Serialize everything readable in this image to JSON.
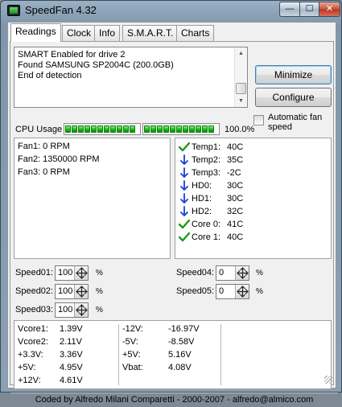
{
  "window": {
    "title": "SpeedFan 4.32",
    "min_glyph": "—",
    "max_glyph": "☐",
    "close_glyph": "✕"
  },
  "tabs": [
    {
      "label": "Readings",
      "active": true
    },
    {
      "label": "Clock"
    },
    {
      "label": "Info"
    },
    {
      "label": "S.M.A.R.T."
    },
    {
      "label": "Charts"
    }
  ],
  "log": [
    "SMART Enabled for drive 2",
    "Found SAMSUNG SP2004C (200.0GB)",
    "End of detection"
  ],
  "buttons": {
    "minimize": "Minimize",
    "configure": "Configure"
  },
  "auto_fan": {
    "label": "Automatic fan speed",
    "checked": false
  },
  "cpu": {
    "label": "CPU Usage",
    "percent_text": "100.0%",
    "usage": 1.0
  },
  "fans": [
    "Fan1: 0 RPM",
    "Fan2: 1350000 RPM",
    "Fan3: 0 RPM"
  ],
  "temps": [
    {
      "name": "Temp1:",
      "value": "40C",
      "icon": "check-icon"
    },
    {
      "name": "Temp2:",
      "value": "35C",
      "icon": "arrow-down-icon"
    },
    {
      "name": "Temp3:",
      "value": "-2C",
      "icon": "arrow-down-icon"
    },
    {
      "name": "HD0:",
      "value": "30C",
      "icon": "arrow-down-icon"
    },
    {
      "name": "HD1:",
      "value": "30C",
      "icon": "arrow-down-icon"
    },
    {
      "name": "HD2:",
      "value": "32C",
      "icon": "arrow-down-icon"
    },
    {
      "name": "Core 0:",
      "value": "41C",
      "icon": "check-icon"
    },
    {
      "name": "Core 1:",
      "value": "40C",
      "icon": "check-icon"
    }
  ],
  "speeds": [
    {
      "label": "Speed01:",
      "value": "100",
      "unit": "%"
    },
    {
      "label": "Speed02:",
      "value": "100",
      "unit": "%"
    },
    {
      "label": "Speed03:",
      "value": "100",
      "unit": "%"
    },
    {
      "label": "Speed04:",
      "value": "0",
      "unit": "%"
    },
    {
      "label": "Speed05:",
      "value": "0",
      "unit": "%"
    }
  ],
  "voltages": [
    {
      "name": "Vcore1:",
      "value": "1.39V"
    },
    {
      "name": "Vcore2:",
      "value": "2.11V"
    },
    {
      "name": "+3.3V:",
      "value": "3.36V"
    },
    {
      "name": "+5V:",
      "value": "4.95V"
    },
    {
      "name": "+12V:",
      "value": "4.61V"
    },
    {
      "name": "-12V:",
      "value": "-16.97V"
    },
    {
      "name": "-5V:",
      "value": "-8.58V"
    },
    {
      "name": "+5V:",
      "value": "5.16V"
    },
    {
      "name": "Vbat:",
      "value": "4.08V"
    }
  ],
  "footer": "Coded by Alfredo Milani Comparetti - 2000-2007 - alfredo@almico.com",
  "colors": {
    "ok": "#1a9a1a",
    "down": "#1a3fd0",
    "bar": "#13b313"
  }
}
